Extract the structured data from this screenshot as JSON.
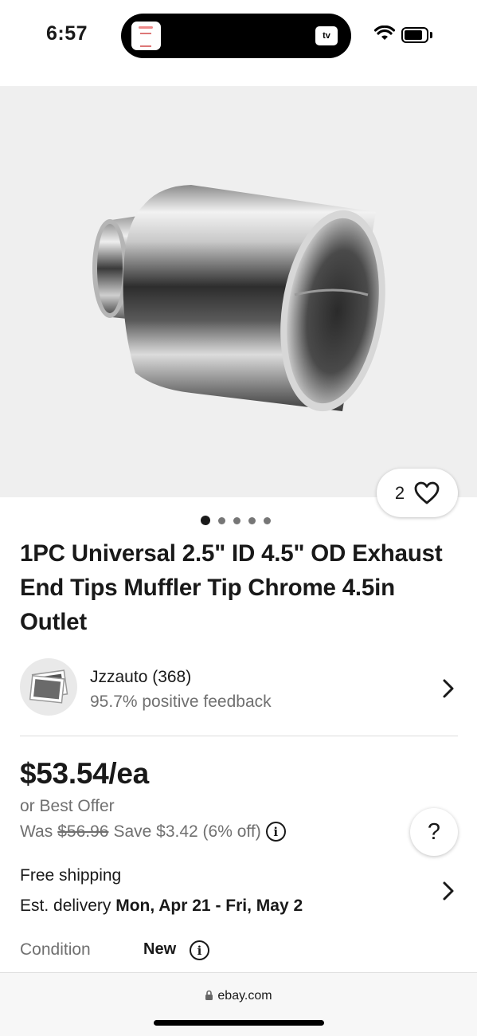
{
  "status_bar": {
    "time": "6:57",
    "island_badge": "tv",
    "icons": [
      "wifi-icon",
      "battery-icon"
    ]
  },
  "gallery": {
    "watch_count": "2",
    "image_count": 5,
    "active_image": 1
  },
  "product": {
    "title": "1PC Universal 2.5\" ID 4.5\" OD Exhaust End Tips Muffler Tip Chrome 4.5in Outlet"
  },
  "seller": {
    "name": "Jzzauto (368)",
    "feedback": "95.7% positive feedback"
  },
  "pricing": {
    "price": "$53.54/ea",
    "best_offer": "or Best Offer",
    "was_label": "Was",
    "was_price": "$56.96",
    "savings": "Save $3.42 (6% off)"
  },
  "help": {
    "label": "?"
  },
  "shipping": {
    "free": "Free shipping",
    "est_label": "Est. delivery",
    "est_dates": "Mon, Apr 21 - Fri, May 2"
  },
  "condition": {
    "label": "Condition",
    "value": "New"
  },
  "browser": {
    "url": "ebay.com"
  },
  "colors": {
    "text": "#191919",
    "secondary": "#707070",
    "image_bg": "#efefef"
  }
}
